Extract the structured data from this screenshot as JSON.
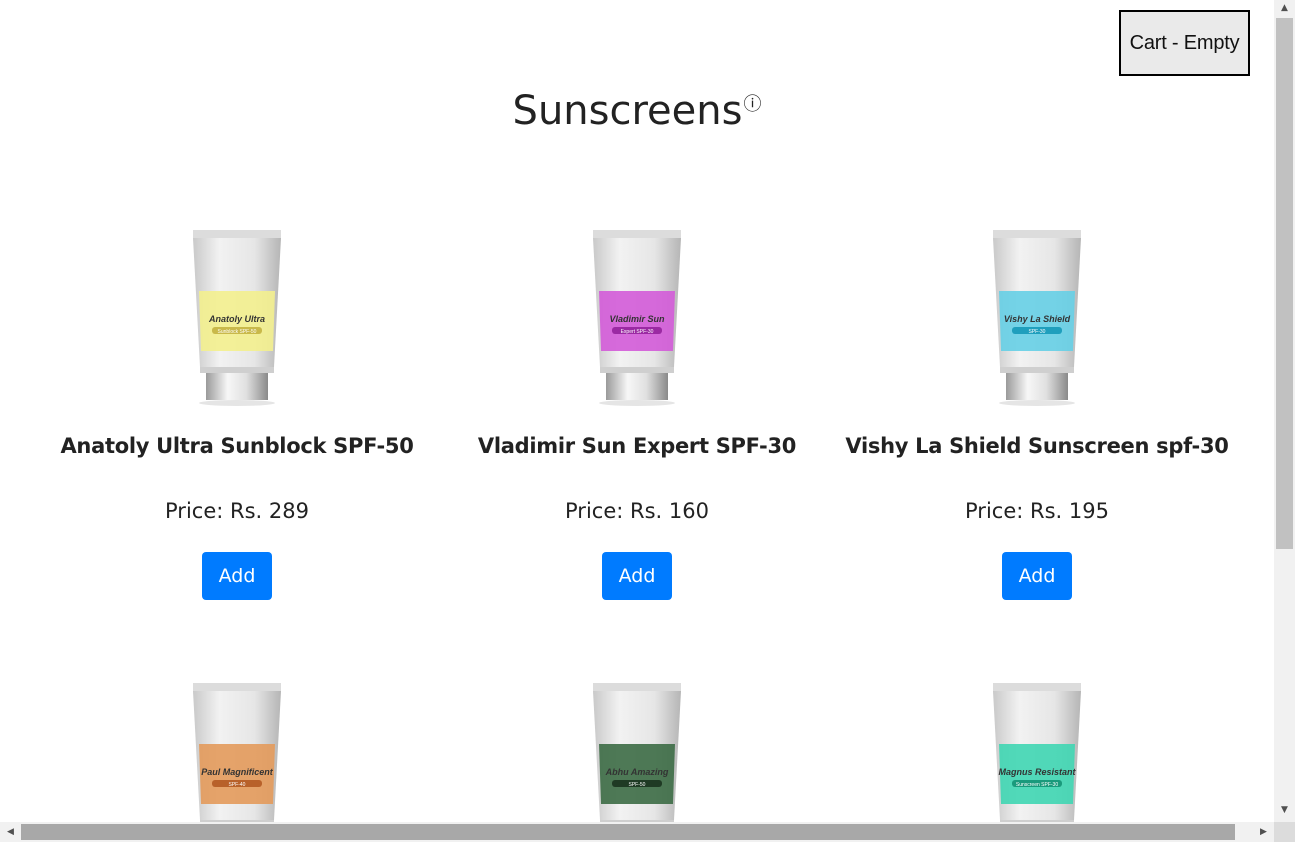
{
  "cart": {
    "label": "Cart - Empty"
  },
  "page": {
    "title": "Sunscreens",
    "info_glyph": "ⓘ"
  },
  "products": [
    {
      "name": "Anatoly Ultra Sunblock SPF-50",
      "price": "Price: Rs. 289",
      "add_label": "Add",
      "label_color": "#f3ef8e",
      "label_line1": "Anatoly Ultra",
      "label_line2": "Sunblock SPF-50",
      "badge_color": "#c9b94a"
    },
    {
      "name": "Vladimir Sun Expert SPF-30",
      "price": "Price: Rs. 160",
      "add_label": "Add",
      "label_color": "#d35bd8",
      "label_line1": "Vladimir Sun",
      "label_line2": "Expert SPF-30",
      "badge_color": "#9b2aa3"
    },
    {
      "name": "Vishy La Shield Sunscreen spf-30",
      "price": "Price: Rs. 195",
      "add_label": "Add",
      "label_color": "#66cfe6",
      "label_line1": "Vishy La Shield",
      "label_line2": "SPF-30",
      "badge_color": "#1f9fbd"
    },
    {
      "name": "",
      "price": "",
      "add_label": "",
      "label_color": "#e39a5b",
      "label_line1": "Paul Magnificent",
      "label_line2": "SPF-40",
      "badge_color": "#b8612a"
    },
    {
      "name": "",
      "price": "",
      "add_label": "",
      "label_color": "#3c6b45",
      "label_line1": "Abhu Amazing",
      "label_line2": "SPF-50",
      "badge_color": "#1f3a24"
    },
    {
      "name": "",
      "price": "",
      "add_label": "",
      "label_color": "#3fd6b2",
      "label_line1": "Magnus Resistant",
      "label_line2": "Sunscreen SPF-30",
      "badge_color": "#1a9a7c"
    }
  ]
}
